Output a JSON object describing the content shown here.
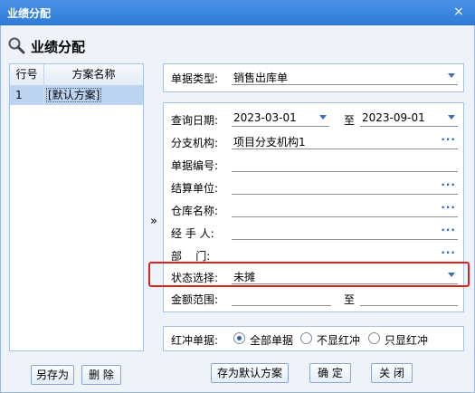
{
  "window": {
    "title": "业绩分配"
  },
  "heading": "业绩分配",
  "scheme_list": {
    "col_row": "行号",
    "col_name": "方案名称",
    "rows": [
      {
        "no": "1",
        "name": "[默认方案]"
      }
    ]
  },
  "doc_type": {
    "label": "单据类型:",
    "value": "销售出库单"
  },
  "form": {
    "date": {
      "label": "查询日期:",
      "from": "2023-03-01",
      "to_label": "至",
      "to": "2023-09-01"
    },
    "branch": {
      "label": "分支机构:",
      "value": "项目分支机构1"
    },
    "doc_no": {
      "label": "单据编号:",
      "value": ""
    },
    "settle": {
      "label": "结算单位:",
      "value": ""
    },
    "warehouse": {
      "label": "仓库名称:",
      "value": ""
    },
    "handler": {
      "label": "经 手 人:",
      "value": ""
    },
    "dept": {
      "label": "部    门:",
      "value": ""
    },
    "status": {
      "label": "状态选择:",
      "value": "未摊"
    },
    "amount": {
      "label": "金额范围:",
      "to_label": "至",
      "from": "",
      "to": ""
    }
  },
  "red": {
    "label": "红冲单据:",
    "options": [
      "全部单据",
      "不显红冲",
      "只显红冲"
    ],
    "selected_index": 0
  },
  "buttons": {
    "save_as": "另存为",
    "delete": "删 除",
    "save_default": "存为默认方案",
    "ok": "确 定",
    "close": "关 闭"
  },
  "collapse_glyph": "»",
  "dots_glyph": "···",
  "close_glyph": "×"
}
